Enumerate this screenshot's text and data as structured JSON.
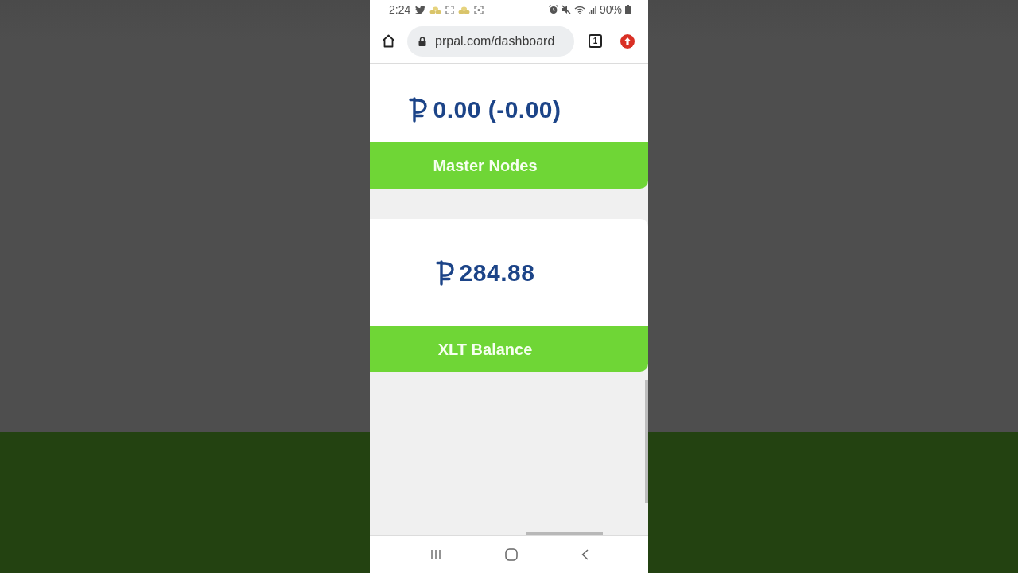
{
  "status_bar": {
    "time": "2:24",
    "battery": "90%"
  },
  "browser": {
    "url": "prpal.com/dashboard",
    "tab_count": "1"
  },
  "cards": [
    {
      "value": "0.00 (-0.00)",
      "label": "Master Nodes"
    },
    {
      "value": "284.88",
      "label": "XLT Balance"
    }
  ]
}
